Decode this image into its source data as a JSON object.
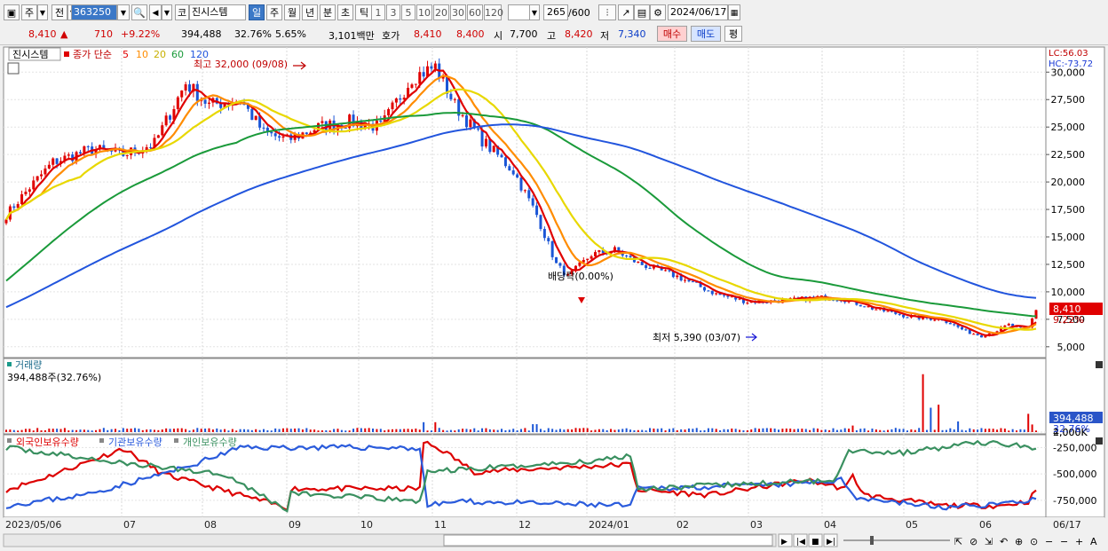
{
  "toolbar": {
    "type_button": "주",
    "range_button": "전",
    "code_value": "363250",
    "market_button": "코",
    "stock_name": "진시스템",
    "periods": [
      "일",
      "주",
      "월",
      "년",
      "분",
      "초",
      "틱"
    ],
    "intervals": [
      "1",
      "3",
      "5",
      "10",
      "20",
      "30",
      "60",
      "120"
    ],
    "count_value": "265",
    "count_total": "/600",
    "date_value": "2024/06/17"
  },
  "quote": {
    "price": "8,410",
    "change": "710",
    "change_pct": "+9.22%",
    "volume": "394,488",
    "volume_ratio": "32.76%",
    "turnover": "5.65%",
    "amount": "3,101백만",
    "hoga_label": "호가",
    "ask": "8,410",
    "bid": "8,400",
    "open_label": "시",
    "open": "7,700",
    "high_label": "고",
    "high": "8,420",
    "low_label": "저",
    "low": "7,340",
    "buy_label": "매수",
    "sell_label": "매도",
    "avg_label": "평"
  },
  "price_panel": {
    "name": "진시스템",
    "ma_label": "종가 단순",
    "ma_periods": [
      "5",
      "10",
      "20",
      "60",
      "120"
    ],
    "ma_colors": [
      "#e00000",
      "#ff8c00",
      "#e8d800",
      "#1a9a3a",
      "#2255dd"
    ],
    "high_note": "최고 32,000 (09/08)",
    "low_note": "최저 5,390 (03/07)",
    "dividend_note": "배당락(0.00%)",
    "lc_label": "LC:56.03",
    "hc_label": "HC:-73.72",
    "current_price": "8,410",
    "current_pct": "9.22%",
    "y_ticks": [
      "30,000",
      "27,500",
      "25,000",
      "22,500",
      "20,000",
      "17,500",
      "15,000",
      "12,500",
      "10,000",
      "7,500",
      "5,000"
    ]
  },
  "volume_panel": {
    "title": "거래량",
    "info": "394,488주(32.76%)",
    "y_ticks": [
      "4,000K",
      "2,000K"
    ],
    "current": "394,488",
    "current_pct": "32.76%"
  },
  "holding_panel": {
    "series": [
      "외국인보유수량",
      "기관보유수량",
      "개인보유수량"
    ],
    "series_colors": [
      "#dd0000",
      "#2a5bdc",
      "#3a9060"
    ],
    "y_ticks": [
      "-250,000",
      "-500,000",
      "-750,000"
    ]
  },
  "x_axis": {
    "labels": [
      "2023/05/06",
      "07",
      "08",
      "09",
      "10",
      "11",
      "12",
      "2024/01",
      "02",
      "03",
      "04",
      "05",
      "06"
    ],
    "last_date": "06/17"
  }
}
